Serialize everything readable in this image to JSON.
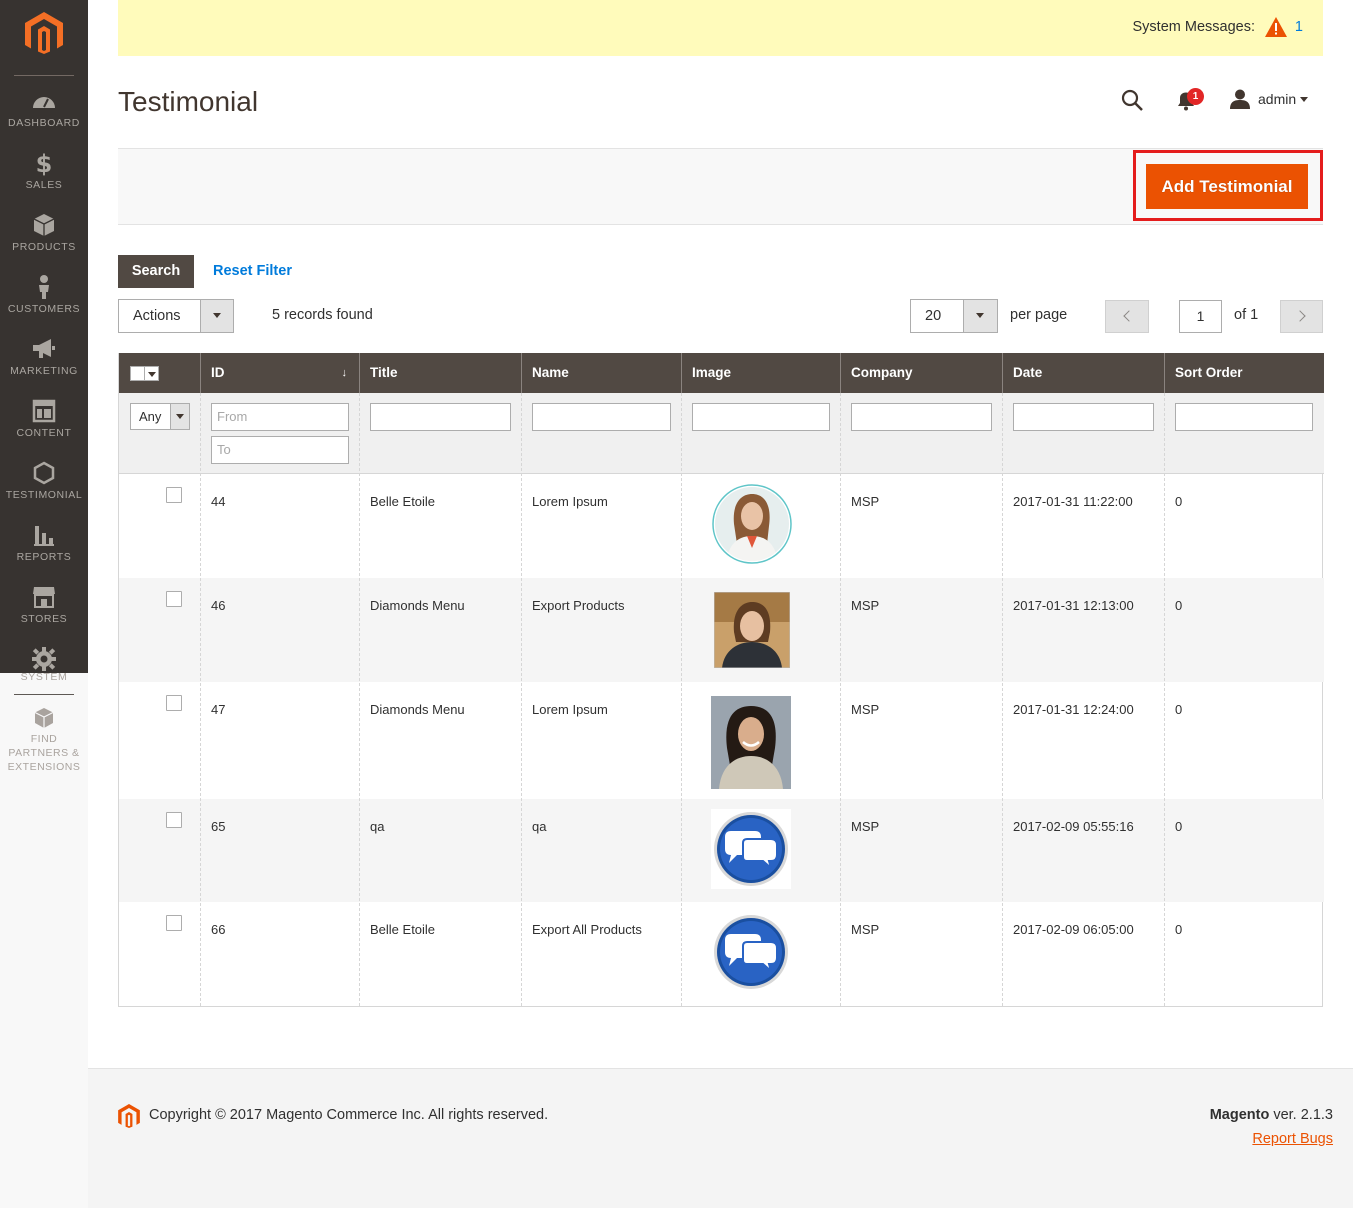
{
  "system_messages": {
    "label": "System Messages:",
    "count": "1"
  },
  "sidebar": {
    "items": [
      {
        "label": "DASHBOARD",
        "icon": "dashboard-icon"
      },
      {
        "label": "SALES",
        "icon": "dollar-icon"
      },
      {
        "label": "PRODUCTS",
        "icon": "cube-icon"
      },
      {
        "label": "CUSTOMERS",
        "icon": "person-icon"
      },
      {
        "label": "MARKETING",
        "icon": "megaphone-icon"
      },
      {
        "label": "CONTENT",
        "icon": "layout-icon"
      },
      {
        "label": "TESTIMONIAL",
        "icon": "hexagon-icon"
      },
      {
        "label": "REPORTS",
        "icon": "bar-chart-icon"
      },
      {
        "label": "STORES",
        "icon": "store-icon"
      },
      {
        "label": "SYSTEM",
        "icon": "gear-icon"
      }
    ],
    "partners": {
      "line1": "FIND",
      "line2": "PARTNERS &",
      "line3": "EXTENSIONS"
    }
  },
  "header": {
    "title": "Testimonial",
    "notifications_count": "1",
    "user": "admin"
  },
  "toolbar": {
    "add_label": "Add Testimonial"
  },
  "filters": {
    "search_label": "Search",
    "reset_label": "Reset Filter"
  },
  "grid_controls": {
    "actions_label": "Actions",
    "records_found": "5 records found",
    "per_page_value": "20",
    "per_page_label": "per page",
    "current_page": "1",
    "page_of": "of 1"
  },
  "grid": {
    "columns": [
      "ID",
      "Title",
      "Name",
      "Image",
      "Company",
      "Date",
      "Sort Order"
    ],
    "filter_any": "Any",
    "filter_from_placeholder": "From",
    "filter_to_placeholder": "To",
    "rows": [
      {
        "id": "44",
        "title": "Belle Etoile",
        "name": "Lorem Ipsum",
        "image": "woman-portrait-round",
        "company": "MSP",
        "date": "2017-01-31 11:22:00",
        "sort": "0"
      },
      {
        "id": "46",
        "title": "Diamonds Menu",
        "name": "Export Products",
        "image": "woman-portrait-square",
        "company": "MSP",
        "date": "2017-01-31 12:13:00",
        "sort": "0"
      },
      {
        "id": "47",
        "title": "Diamonds Menu",
        "name": "Lorem Ipsum",
        "image": "woman-portrait-tall",
        "company": "MSP",
        "date": "2017-01-31 12:24:00",
        "sort": "0"
      },
      {
        "id": "65",
        "title": "qa",
        "name": "qa",
        "image": "chat-bubbles-icon",
        "company": "MSP",
        "date": "2017-02-09 05:55:16",
        "sort": "0"
      },
      {
        "id": "66",
        "title": "Belle Etoile",
        "name": "Export All Products",
        "image": "chat-bubbles-icon",
        "company": "MSP",
        "date": "2017-02-09 06:05:00",
        "sort": "0"
      }
    ]
  },
  "footer": {
    "copyright": "Copyright © 2017 Magento Commerce Inc. All rights reserved.",
    "brand": "Magento",
    "version": " ver. 2.1.3",
    "report_bugs": "Report Bugs"
  },
  "colors": {
    "accent": "#eb5202",
    "sidebar": "#373330",
    "grid_header": "#514943",
    "link": "#007bdb"
  }
}
